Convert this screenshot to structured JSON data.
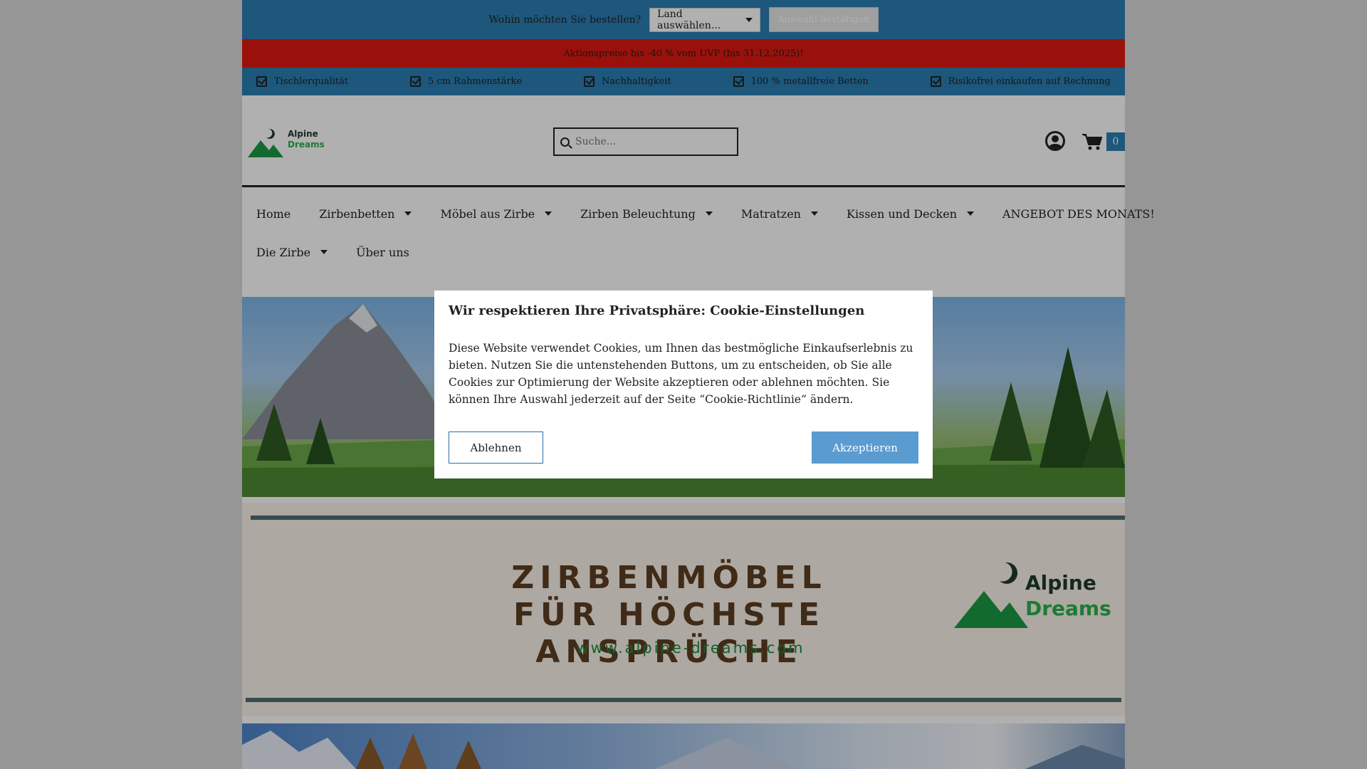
{
  "topbar": {
    "question": "Wohin möchten Sie bestellen?",
    "country_selected": "Land auswählen...",
    "confirm_label": "Auswahl bestätigen"
  },
  "promo": {
    "text": "Aktionspreise bis -40 % vom UVP (bis 31.12.2025)!"
  },
  "usp": [
    {
      "label": "Tischlerqualität",
      "icon": "check-square-icon"
    },
    {
      "label": "5 cm Rahmenstärke",
      "icon": "check-square-icon"
    },
    {
      "label": "Nachhaltigkeit",
      "icon": "check-square-icon"
    },
    {
      "label": "100 % metallfreie Betten",
      "icon": "check-square-icon"
    },
    {
      "label": "Risikofrei einkaufen auf Rechnung",
      "icon": "check-square-icon"
    }
  ],
  "header": {
    "logo": {
      "line1": "Alpine",
      "line2": "Dreams"
    },
    "search_placeholder": "Suche...",
    "cart_count": "0"
  },
  "nav": {
    "row1": [
      {
        "label": "Home",
        "dropdown": false
      },
      {
        "label": "Zirbenbetten",
        "dropdown": true
      },
      {
        "label": "Möbel aus Zirbe",
        "dropdown": true
      },
      {
        "label": "Zirben Beleuchtung",
        "dropdown": true
      },
      {
        "label": "Matratzen",
        "dropdown": true
      },
      {
        "label": "Kissen und Decken",
        "dropdown": true
      },
      {
        "label": "ANGEBOT DES MONATS!",
        "dropdown": false
      }
    ],
    "row2": [
      {
        "label": "Die Zirbe",
        "dropdown": true
      },
      {
        "label": "Über uns",
        "dropdown": false
      }
    ]
  },
  "banner": {
    "line1": "ZIRBENMÖBEL",
    "line2": "FÜR HÖCHSTE ANSPRÜCHE",
    "url": "www.alpine-dreams.com",
    "brand_line1": "Alpine",
    "brand_line2": "Dreams"
  },
  "cookie_modal": {
    "title": "Wir respektieren Ihre Privatsphäre: Cookie-Einstellungen",
    "text": "Diese Website verwendet Cookies, um Ihnen das bestmögliche Einkaufserlebnis zu bieten. Nutzen Sie die untenstehenden Buttons, um zu entscheiden, ob Sie alle Cookies zur Optimierung der Website akzeptieren oder ablehnen möchten. Sie können Ihre Auswahl jederzeit auf der Seite “Cookie-Richtlinie“ ändern.",
    "decline_label": "Ablehnen",
    "accept_label": "Akzeptieren"
  },
  "colors": {
    "topbar_blue": "#2a7fb4",
    "promo_red": "#e01a12",
    "brand_dark": "#1e3a2e",
    "brand_green": "#2bb24c",
    "accept_blue": "#5a9bd0"
  }
}
